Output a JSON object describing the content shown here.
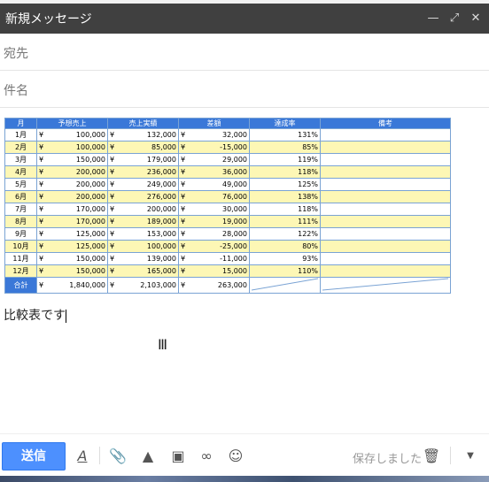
{
  "window": {
    "title": "新規メッセージ"
  },
  "fields": {
    "to_label": "宛先",
    "subject_label": "件名"
  },
  "table": {
    "headers": [
      "月",
      "予想売上",
      "売上実績",
      "差額",
      "達成率",
      "備考"
    ],
    "currency": "¥",
    "rows": [
      {
        "month": "1月",
        "forecast": "100,000",
        "actual": "132,000",
        "diff": "32,000",
        "rate": "131%"
      },
      {
        "month": "2月",
        "forecast": "100,000",
        "actual": "85,000",
        "diff": "-15,000",
        "rate": "85%"
      },
      {
        "month": "3月",
        "forecast": "150,000",
        "actual": "179,000",
        "diff": "29,000",
        "rate": "119%"
      },
      {
        "month": "4月",
        "forecast": "200,000",
        "actual": "236,000",
        "diff": "36,000",
        "rate": "118%"
      },
      {
        "month": "5月",
        "forecast": "200,000",
        "actual": "249,000",
        "diff": "49,000",
        "rate": "125%"
      },
      {
        "month": "6月",
        "forecast": "200,000",
        "actual": "276,000",
        "diff": "76,000",
        "rate": "138%"
      },
      {
        "month": "7月",
        "forecast": "170,000",
        "actual": "200,000",
        "diff": "30,000",
        "rate": "118%"
      },
      {
        "month": "8月",
        "forecast": "170,000",
        "actual": "189,000",
        "diff": "19,000",
        "rate": "111%"
      },
      {
        "month": "9月",
        "forecast": "125,000",
        "actual": "153,000",
        "diff": "28,000",
        "rate": "122%"
      },
      {
        "month": "10月",
        "forecast": "125,000",
        "actual": "100,000",
        "diff": "-25,000",
        "rate": "80%"
      },
      {
        "month": "11月",
        "forecast": "150,000",
        "actual": "139,000",
        "diff": "-11,000",
        "rate": "93%"
      },
      {
        "month": "12月",
        "forecast": "150,000",
        "actual": "165,000",
        "diff": "15,000",
        "rate": "110%"
      }
    ],
    "total": {
      "label": "合計",
      "forecast": "1,840,000",
      "actual": "2,103,000",
      "diff": "263,000"
    }
  },
  "body": {
    "text": "比較表です"
  },
  "toolbar": {
    "send_label": "送信",
    "saved_label": "保存しました"
  },
  "colors": {
    "header_blue": "#3a78d8",
    "stripe_yellow": "#fdf7b5",
    "send_blue": "#4d90fe"
  }
}
